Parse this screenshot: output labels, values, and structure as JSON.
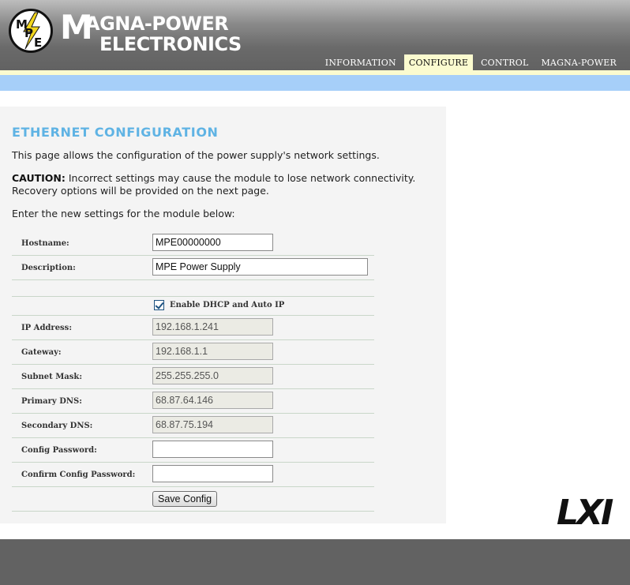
{
  "brand": {
    "logo_letters": [
      "M",
      "P",
      "E"
    ],
    "name_line1_initial": "M",
    "name_line1_rest": "AGNA-POWER",
    "name_line2": "ELECTRONICS"
  },
  "nav": {
    "tabs": [
      {
        "label": "INFORMATION",
        "active": false
      },
      {
        "label": "CONFIGURE",
        "active": true
      },
      {
        "label": "CONTROL",
        "active": false
      },
      {
        "label": "MAGNA-POWER",
        "active": false
      }
    ]
  },
  "page": {
    "title": "ETHERNET CONFIGURATION",
    "intro": "This page allows the configuration of the power supply's network settings.",
    "caution_label": "CAUTION:",
    "caution_text": " Incorrect settings may cause the module to lose network connectivity. Recovery options will be provided on the next page.",
    "enter_text": "Enter the new settings for the module below:"
  },
  "form": {
    "hostname": {
      "label": "Hostname:",
      "value": "MPE00000000"
    },
    "description": {
      "label": "Description:",
      "value": "MPE Power Supply"
    },
    "dhcp": {
      "label": "Enable DHCP and Auto IP",
      "checked": true
    },
    "ip_address": {
      "label": "IP Address:",
      "value": "192.168.1.241"
    },
    "gateway": {
      "label": "Gateway:",
      "value": "192.168.1.1"
    },
    "subnet_mask": {
      "label": "Subnet Mask:",
      "value": "255.255.255.0"
    },
    "primary_dns": {
      "label": "Primary DNS:",
      "value": "68.87.64.146"
    },
    "secondary_dns": {
      "label": "Secondary DNS:",
      "value": "68.87.75.194"
    },
    "config_password": {
      "label": "Config Password:",
      "value": ""
    },
    "confirm_password": {
      "label": "Confirm Config Password:",
      "value": ""
    },
    "save_label": "Save Config"
  },
  "lxi_logo": "LXI",
  "colors": {
    "title": "#5fb3e4",
    "blue_band": "#a6cff9",
    "cream": "#fbfbcf",
    "header_dark": "#626262"
  }
}
